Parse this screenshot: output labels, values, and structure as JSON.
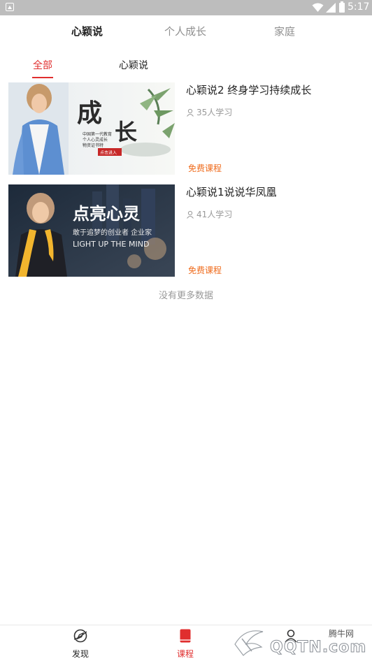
{
  "status_bar": {
    "time": "5:17"
  },
  "top_tabs": [
    {
      "label": "心颖说",
      "active": true
    },
    {
      "label": "个人成长",
      "active": false
    },
    {
      "label": "家庭",
      "active": false
    }
  ],
  "sub_tabs": [
    {
      "label": "全部",
      "active": true
    },
    {
      "label": "心颖说",
      "active": false
    }
  ],
  "courses": [
    {
      "title": "心颖说2 终身学习持续成长",
      "learners": "35人学习",
      "tag": "免费课程",
      "thumb": {
        "calligraphy_1": "成",
        "calligraphy_2": "长",
        "line_1": "中国第一代教育",
        "line_2": "个人心灵成长",
        "line_3": "物资证书特",
        "stamp": "点击进入"
      }
    },
    {
      "title": "心颖说1说说华凤凰",
      "learners": "41人学习",
      "tag": "免费课程",
      "thumb": {
        "headline": "点亮心灵",
        "subline": "敢于追梦的创业者 企业家",
        "english": "LIGHT UP THE MIND"
      }
    }
  ],
  "no_more_text": "没有更多数据",
  "bottom_nav": [
    {
      "label": "发现",
      "active": false
    },
    {
      "label": "课程",
      "active": true
    },
    {
      "label": "",
      "active": false
    }
  ],
  "watermark": {
    "brand": "腾牛网",
    "domain": "QQTN.com"
  },
  "colors": {
    "accent": "#e02e2e",
    "free_tag": "#ef6b1c",
    "muted": "#999999"
  }
}
